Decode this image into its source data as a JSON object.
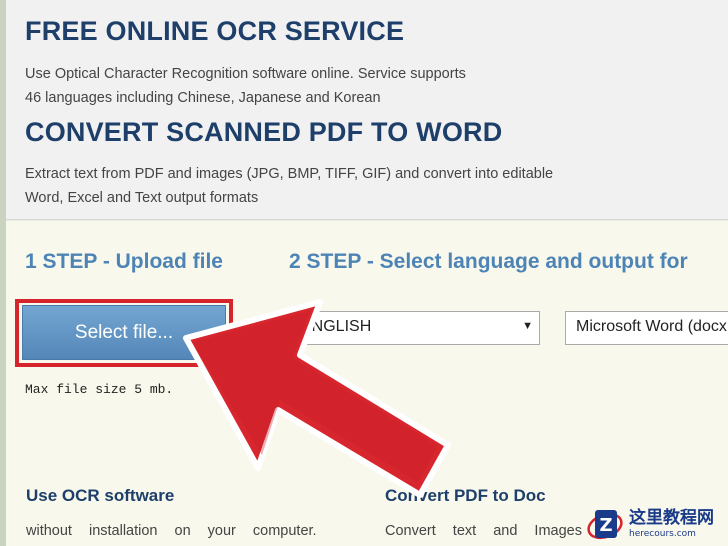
{
  "header": {
    "title1": "FREE ONLINE OCR SERVICE",
    "desc1_line1": "Use Optical Character Recognition software online. Service supports",
    "desc1_line2": "46 languages including Chinese, Japanese and Korean",
    "title2": "CONVERT SCANNED PDF TO WORD",
    "desc2_line1": "Extract text from PDF and images (JPG, BMP, TIFF, GIF) and convert into editable",
    "desc2_line2": "Word, Excel and Text output formats"
  },
  "steps": {
    "step1": "1 STEP - Upload file",
    "step2": "2 STEP - Select language and output for"
  },
  "upload": {
    "button_label": "Select file...",
    "max_size": "Max file size 5 mb."
  },
  "options": {
    "language": "ENGLISH",
    "output_format": "Microsoft Word (docx"
  },
  "features": [
    {
      "title": "Use OCR software",
      "text": "without installation on your computer."
    },
    {
      "title": "Convert PDF to Doc",
      "text": "Convert text and Images f"
    }
  ],
  "watermark": {
    "text": "这里教程网",
    "url": "herecours.com"
  },
  "colors": {
    "heading": "#1e3f6a",
    "step": "#4d84b5",
    "button": "#5f93c4",
    "highlight": "#d6242c"
  },
  "icons": {
    "arrow": "pointer-arrow-icon",
    "caret": "dropdown-caret-icon",
    "logo": "watermark-logo-icon"
  }
}
